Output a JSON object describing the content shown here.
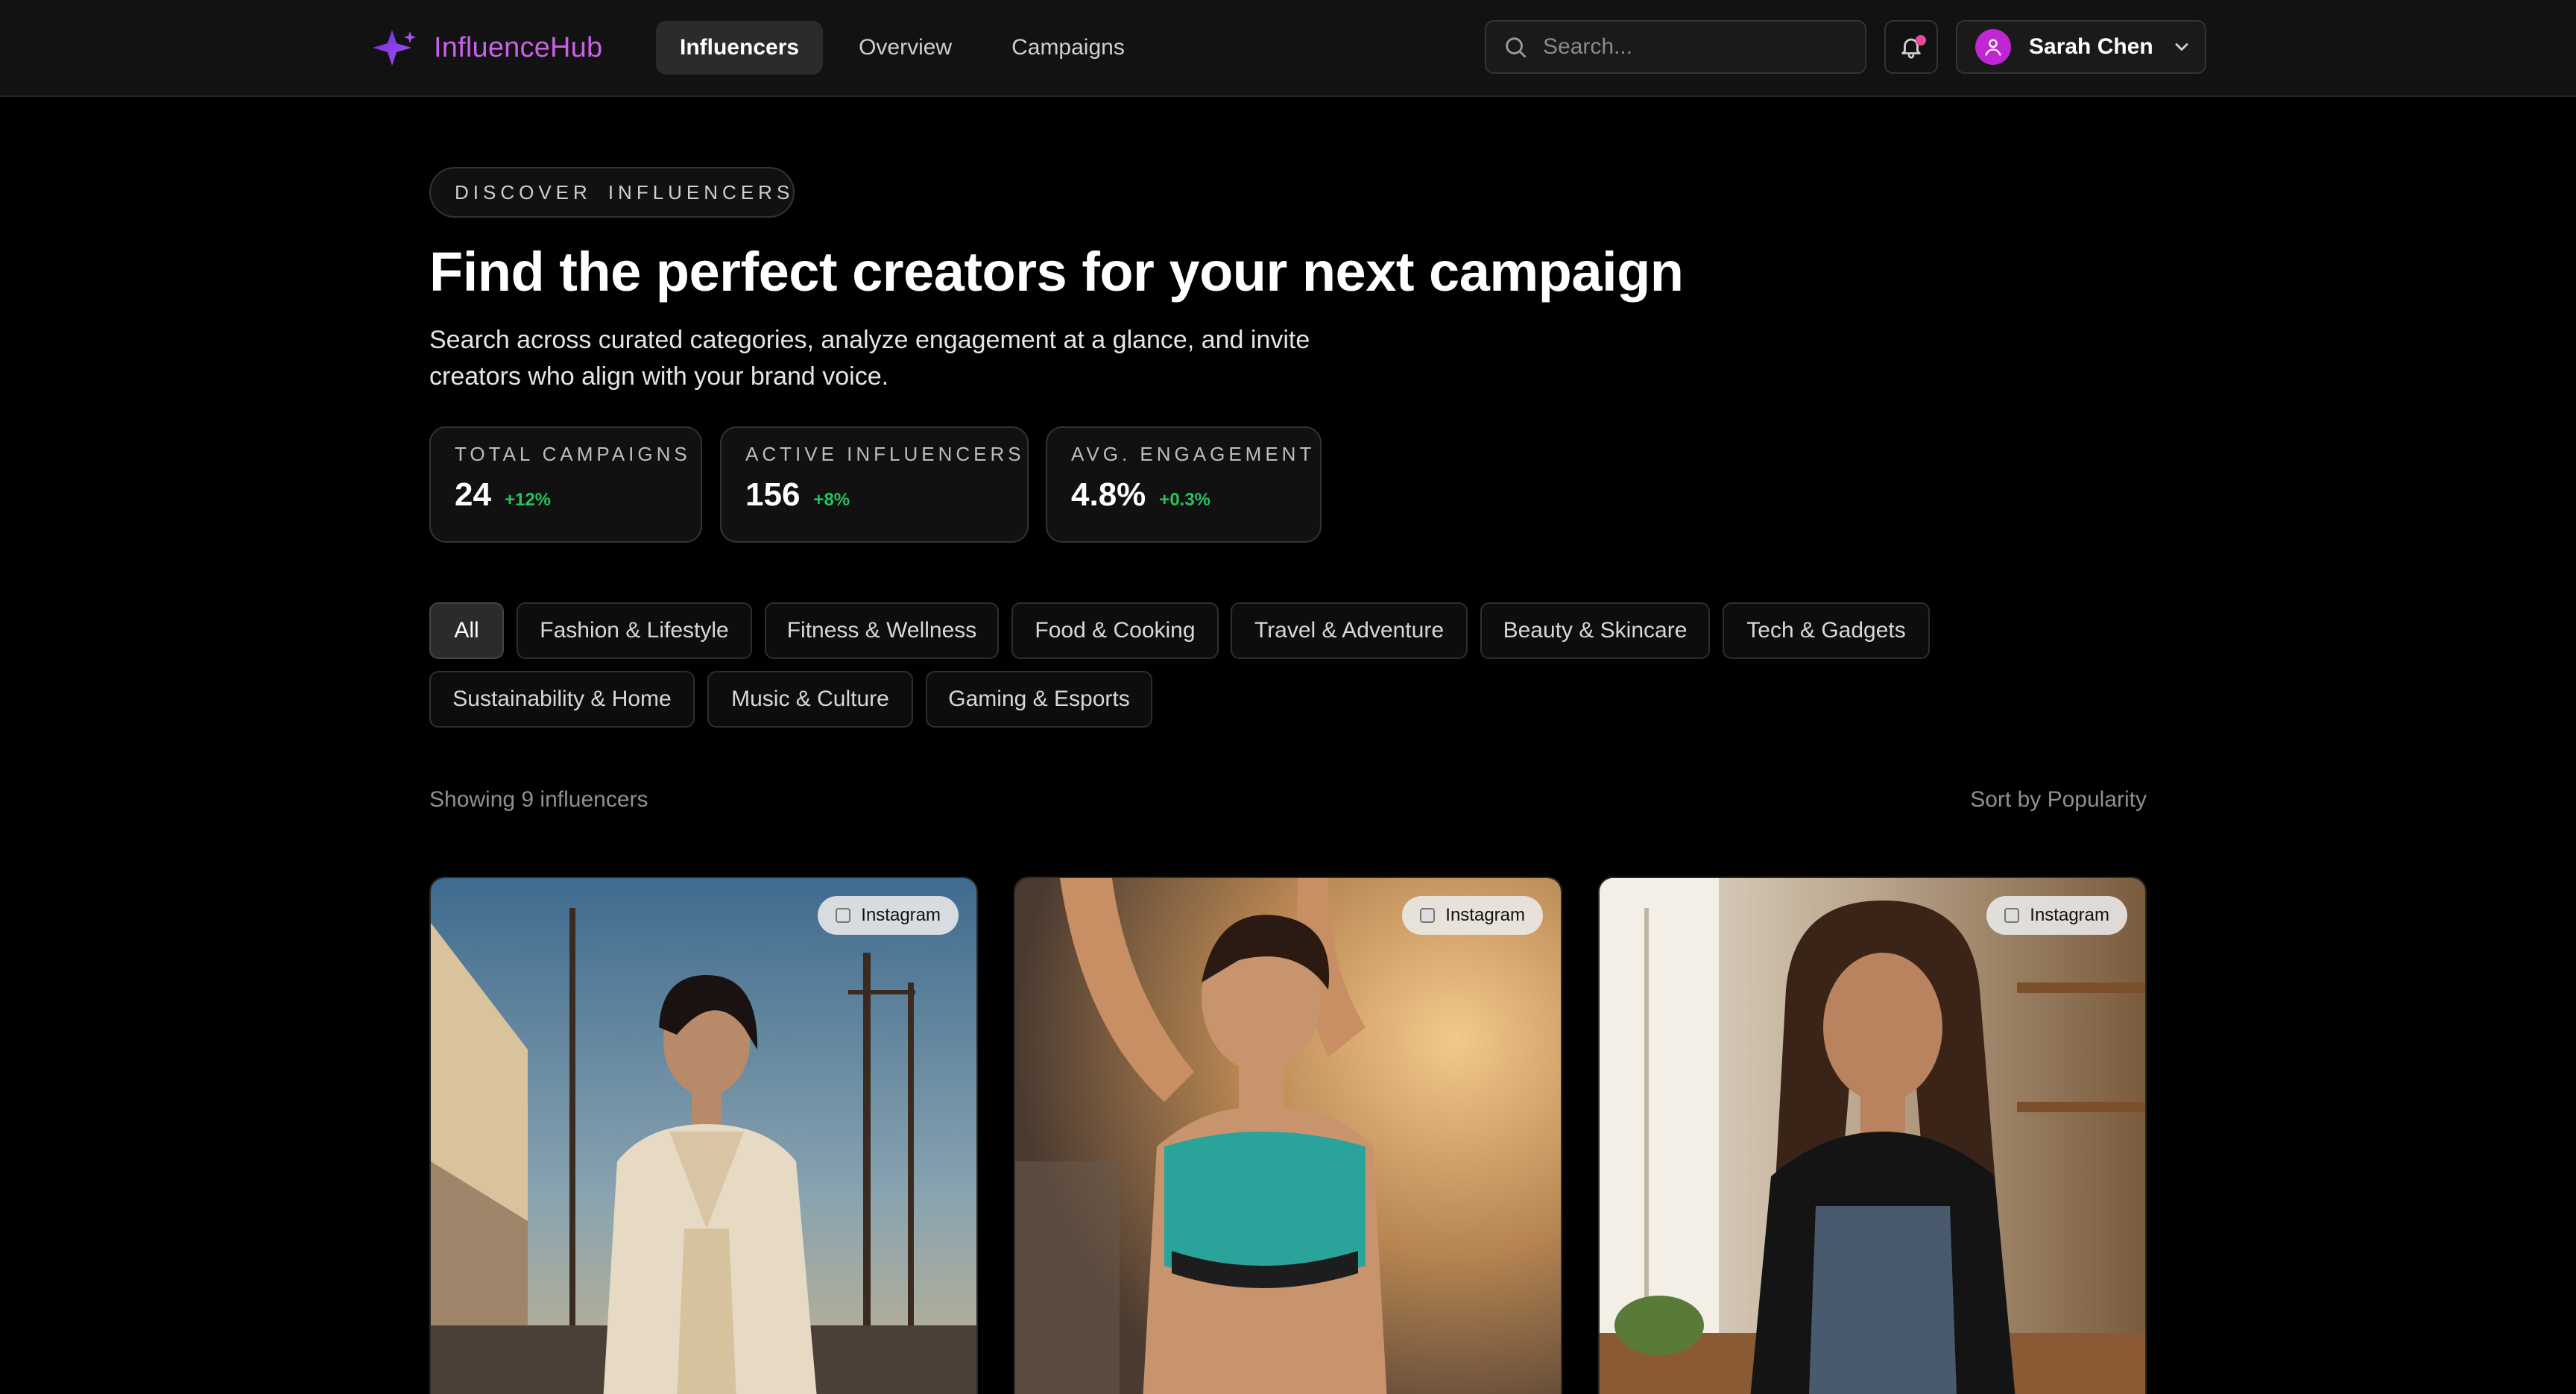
{
  "nav": {
    "brand": "InfluenceHub",
    "links": [
      {
        "label": "Influencers",
        "active": true
      },
      {
        "label": "Overview",
        "active": false
      },
      {
        "label": "Campaigns",
        "active": false
      }
    ],
    "search_placeholder": "Search...",
    "user_name": "Sarah Chen",
    "icons": [
      "sparkle-logo-icon",
      "search-icon",
      "bell-icon",
      "user-icon",
      "chevron-down-icon"
    ]
  },
  "hero": {
    "pill_left": "DISCOVER",
    "pill_right": "INFLUENCERS",
    "headline": "Find the perfect creators for your next campaign",
    "subtext": "Search across curated categories, analyze engagement at a glance, and invite creators who align with your brand voice."
  },
  "stats": [
    {
      "label": "TOTAL CAMPAIGNS",
      "value": "24",
      "delta": "+12%"
    },
    {
      "label": "ACTIVE INFLUENCERS",
      "value": "156",
      "delta": "+8%"
    },
    {
      "label": "AVG. ENGAGEMENT",
      "value": "4.8%",
      "delta": "+0.3%"
    }
  ],
  "categories": [
    {
      "label": "All",
      "active": true
    },
    {
      "label": "Fashion & Lifestyle"
    },
    {
      "label": "Fitness & Wellness"
    },
    {
      "label": "Food & Cooking"
    },
    {
      "label": "Travel & Adventure"
    },
    {
      "label": "Beauty & Skincare"
    },
    {
      "label": "Tech & Gadgets"
    },
    {
      "label": "Sustainability & Home"
    },
    {
      "label": "Music & Culture"
    },
    {
      "label": "Gaming & Esports"
    }
  ],
  "results": {
    "showing": "Showing 9 influencers",
    "sort": "Sort by Popularity"
  },
  "cards": [
    {
      "platform": "Instagram"
    },
    {
      "platform": "Instagram"
    },
    {
      "platform": "Instagram"
    }
  ],
  "colors": {
    "brand": "#c861e8",
    "accent_pink": "#ec4899",
    "positive": "#22c55e"
  }
}
